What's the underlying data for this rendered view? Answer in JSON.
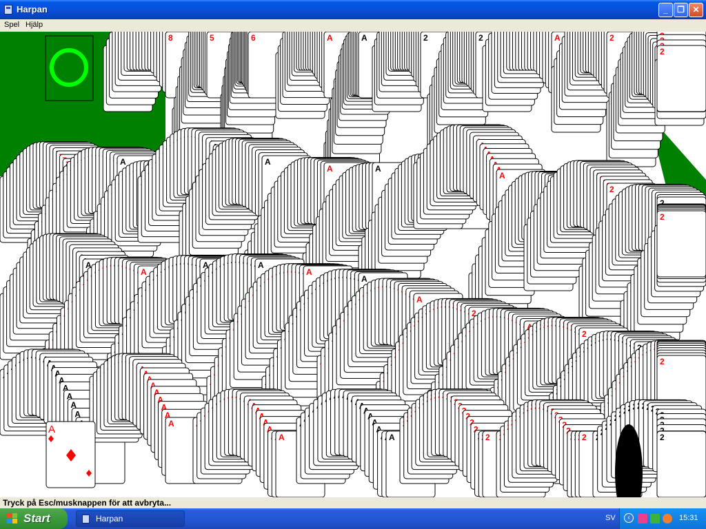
{
  "window": {
    "title": "Harpan"
  },
  "menu": {
    "items": [
      "Spel",
      "Hjälp"
    ]
  },
  "status": {
    "message": "Tryck på Esc/musknappen för att avbryta..."
  },
  "taskbar": {
    "start_label": "Start",
    "task_label": "Harpan",
    "language": "SV",
    "clock": "15:31"
  },
  "board": {
    "felt_color": "#008000",
    "foundation_ring_color": "#00ff00",
    "featured_card": {
      "rank": "A",
      "suit": "diamonds"
    }
  },
  "icons": [
    "window-app-icon",
    "minimize-icon",
    "maximize-icon",
    "close-icon",
    "windows-logo-icon",
    "foundation-ring-icon",
    "tray-chevron-icon",
    "tray-network-icon",
    "tray-security-icon",
    "tray-volume-icon"
  ],
  "colors": {
    "titlebar": "#0a4fd6",
    "taskbar": "#245edc",
    "start": "#3c9a3c",
    "tray": "#1990f0",
    "card_red": "#ff0000",
    "card_black": "#000000"
  }
}
